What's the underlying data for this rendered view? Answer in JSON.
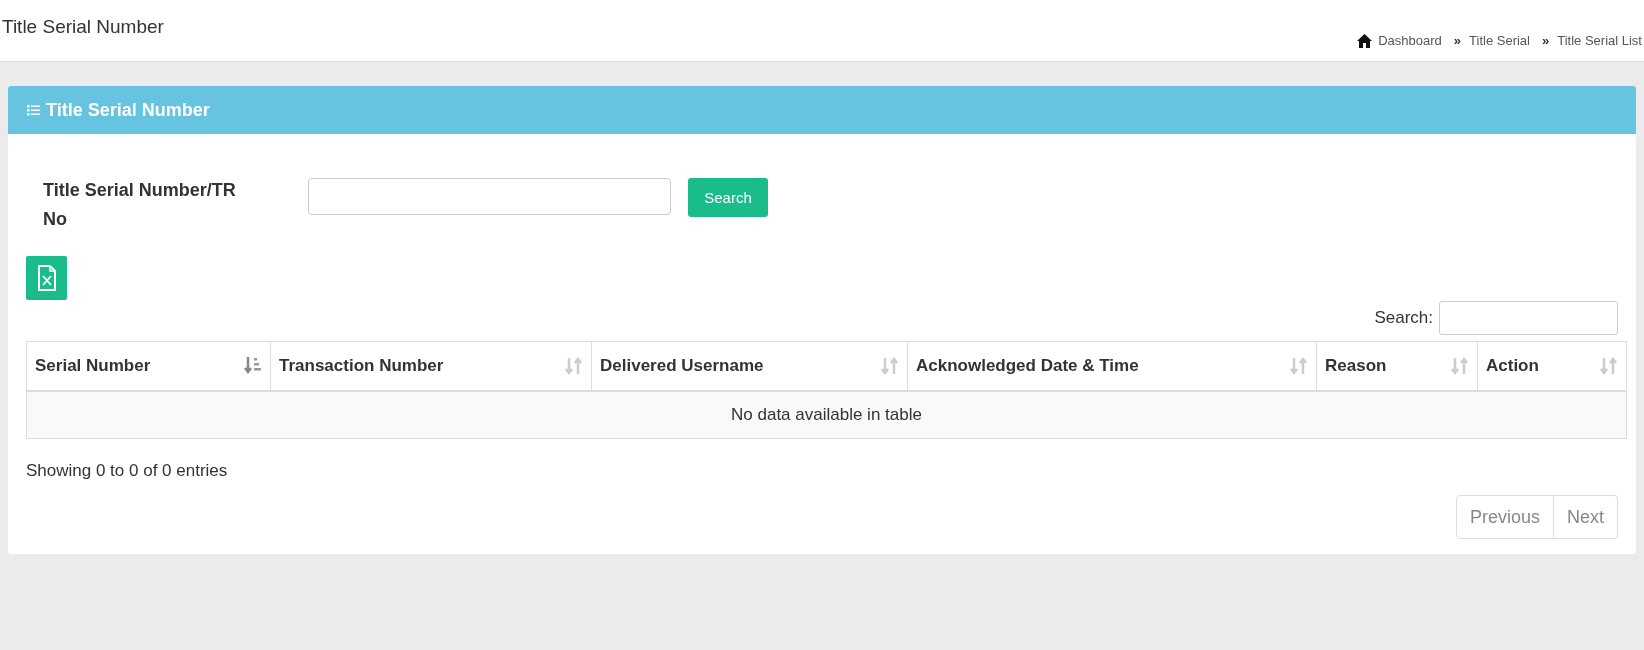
{
  "page_title": "Title Serial Number",
  "breadcrumb": [
    {
      "label": "Dashboard",
      "kind": "home"
    },
    {
      "label": "Title Serial",
      "kind": "link"
    },
    {
      "label": "Title Serial List",
      "kind": "link"
    }
  ],
  "separator": "»",
  "panel": {
    "title": "Title Serial Number",
    "form": {
      "label": "Title Serial Number/TR No",
      "button": "Search"
    },
    "table_search": {
      "label": "Search:"
    },
    "table": {
      "columns": [
        {
          "label": "Serial Number",
          "sorted": true
        },
        {
          "label": "Transaction Number",
          "sorted": false
        },
        {
          "label": "Delivered Username",
          "sorted": false
        },
        {
          "label": "Acknowledged Date & Time",
          "sorted": false
        },
        {
          "label": "Reason",
          "sorted": false
        },
        {
          "label": "Action",
          "sorted": false
        }
      ],
      "empty_message": "No data available in table"
    },
    "info": "Showing 0 to 0 of 0 entries",
    "pagination": [
      {
        "label": "Previous",
        "disabled": true
      },
      {
        "label": "Next",
        "disabled": true
      }
    ]
  }
}
